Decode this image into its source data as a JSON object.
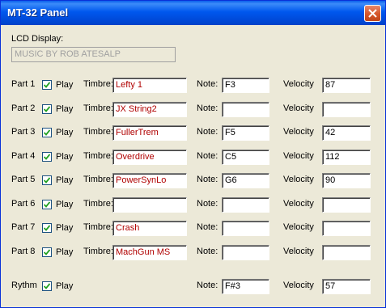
{
  "window": {
    "title": "MT-32 Panel"
  },
  "lcd": {
    "label": "LCD Display:",
    "value": "MUSIC BY ROB ATESALP"
  },
  "labels": {
    "timbre": "Timbre:",
    "note": "Note:",
    "velocity": "Velocity",
    "play": "Play"
  },
  "parts": [
    {
      "label": "Part 1",
      "play": true,
      "timbre": "Lefty 1",
      "note": "F3",
      "velocity": "87"
    },
    {
      "label": "Part 2",
      "play": true,
      "timbre": "JX String2",
      "note": "",
      "velocity": ""
    },
    {
      "label": "Part 3",
      "play": true,
      "timbre": "FullerTrem",
      "note": "F5",
      "velocity": "42"
    },
    {
      "label": "Part 4",
      "play": true,
      "timbre": "Overdrive",
      "note": "C5",
      "velocity": "112"
    },
    {
      "label": "Part 5",
      "play": true,
      "timbre": "PowerSynLo",
      "note": "G6",
      "velocity": "90"
    },
    {
      "label": "Part 6",
      "play": true,
      "timbre": "",
      "note": "",
      "velocity": ""
    },
    {
      "label": "Part 7",
      "play": true,
      "timbre": "Crash",
      "note": "",
      "velocity": ""
    },
    {
      "label": "Part 8",
      "play": true,
      "timbre": "MachGun MS",
      "note": "",
      "velocity": ""
    }
  ],
  "rhythm": {
    "label": "Rythm",
    "play": true,
    "note": "F#3",
    "velocity": "57"
  },
  "colors": {
    "titlebar": "#0058EE",
    "timbre_text": "#B00000",
    "background": "#ECE9D8"
  }
}
